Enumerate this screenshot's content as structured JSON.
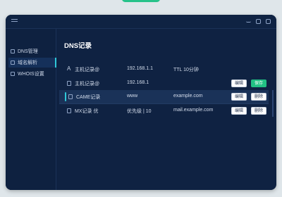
{
  "sidebar": {
    "items": [
      {
        "label": "DNS管理"
      },
      {
        "label": "域名解析"
      },
      {
        "label": "WHOIS设置"
      }
    ]
  },
  "main": {
    "title": "DNS记录",
    "records": [
      {
        "icon": "A",
        "type": "主机记录@",
        "value": "192.168.1.1",
        "extra": "TTL 10分钟"
      },
      {
        "type": "主机记录@",
        "value": "192.168.1",
        "actions": [
          "编辑",
          "保存"
        ]
      },
      {
        "type": "CAME记录",
        "value": "www",
        "extra": "example.com",
        "actions": [
          "编辑",
          "删除"
        ]
      },
      {
        "type": "MX记录 优",
        "value": "优先级 | 10",
        "extra": "mail.example.com",
        "actions": [
          "编辑",
          "删除"
        ]
      }
    ]
  },
  "colors": {
    "window_bg": "#0f2242",
    "accent": "#2fc8d8",
    "save_green": "#22c184"
  }
}
